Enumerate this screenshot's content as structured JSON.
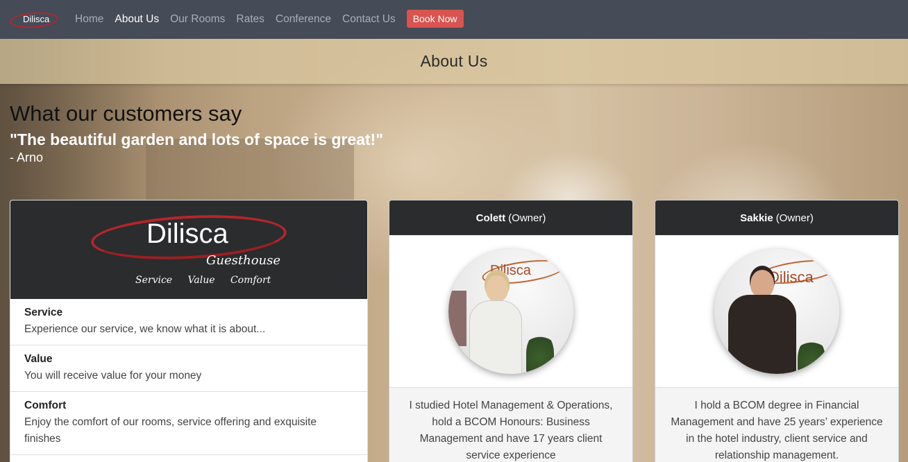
{
  "nav": {
    "brand": "Dilisca",
    "links": [
      "Home",
      "About Us",
      "Our Rooms",
      "Rates",
      "Conference",
      "Contact Us"
    ],
    "active": "About Us",
    "book_label": "Book Now"
  },
  "header": {
    "title": "About Us"
  },
  "testimonial": {
    "heading": "What our customers say",
    "quote": "\"The beautiful garden and lots of space is great!\"",
    "author": "- Arno"
  },
  "brand_card": {
    "logo_name": "Dilisca",
    "logo_sub": "Guesthouse",
    "logo_tags": [
      "Service",
      "Value",
      "Comfort"
    ],
    "features": [
      {
        "title": "Service",
        "desc": "Experience our service, we know what it is about..."
      },
      {
        "title": "Value",
        "desc": "You will receive value for your money"
      },
      {
        "title": "Comfort",
        "desc": "Enjoy the comfort of our rooms, service offering and exquisite finishes"
      }
    ]
  },
  "owners": [
    {
      "name": "Colett",
      "role": "(Owner)",
      "bio": "I studied Hotel Management & Operations, hold a BCOM Honours: Business Management and have 17 years client service experience"
    },
    {
      "name": "Sakkie",
      "role": "(Owner)",
      "bio": "I hold a BCOM degree in Financial Management and have 25 years’ experience in the hotel industry, client service and relationship management."
    }
  ],
  "photo_wall_logo": "Dilisca",
  "colors": {
    "navbar": "#454b57",
    "book_button": "#d9534f",
    "card_header": "#2b2c2e",
    "logo_red": "#b3262b"
  }
}
